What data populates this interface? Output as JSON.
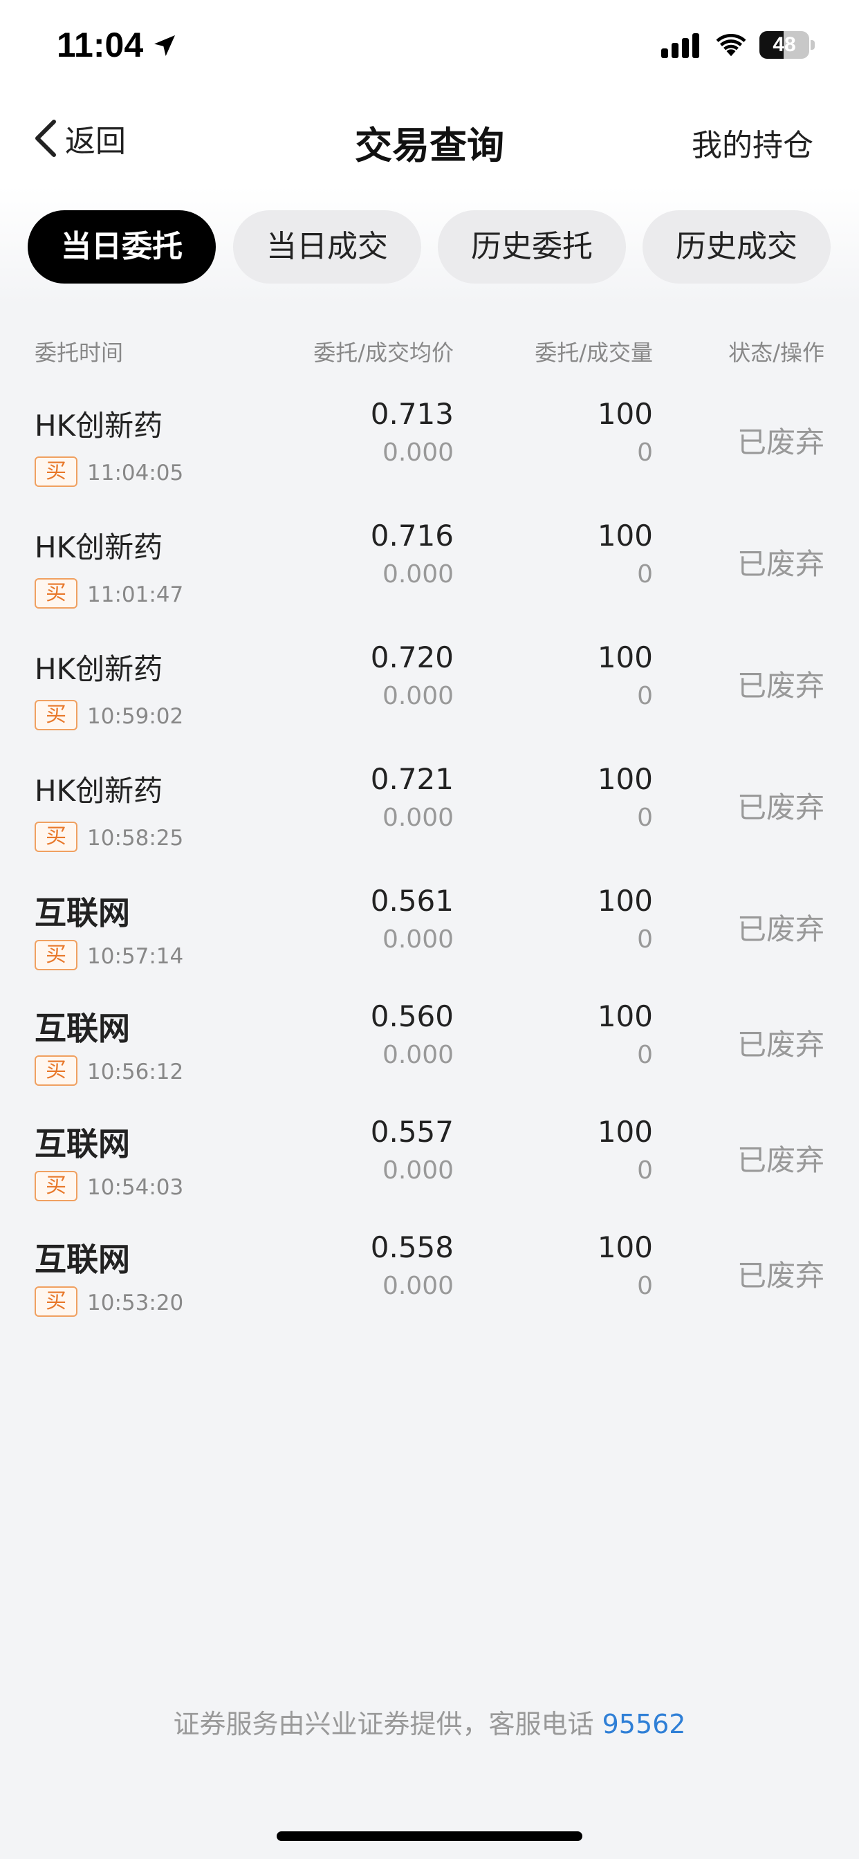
{
  "status_bar": {
    "time": "11:04",
    "battery": "48",
    "battery_level": 0.48,
    "icons": [
      "location-arrow-icon",
      "cellular-signal-icon",
      "wifi-icon",
      "battery-icon"
    ]
  },
  "nav": {
    "back_label": "返回",
    "title": "交易查询",
    "right_label": "我的持仓"
  },
  "tabs": [
    {
      "label": "当日委托",
      "active": true
    },
    {
      "label": "当日成交",
      "active": false
    },
    {
      "label": "历史委托",
      "active": false
    },
    {
      "label": "历史成交",
      "active": false
    }
  ],
  "table": {
    "headers": {
      "time": "委托时间",
      "price": "委托/成交均价",
      "qty": "委托/成交量",
      "status": "状态/操作"
    },
    "rows": [
      {
        "name": "HK创新药",
        "side": "买",
        "time": "11:04:05",
        "price": "0.713",
        "avg_price": "0.000",
        "qty": "100",
        "filled": "0",
        "status": "已废弃"
      },
      {
        "name": "HK创新药",
        "side": "买",
        "time": "11:01:47",
        "price": "0.716",
        "avg_price": "0.000",
        "qty": "100",
        "filled": "0",
        "status": "已废弃"
      },
      {
        "name": "HK创新药",
        "side": "买",
        "time": "10:59:02",
        "price": "0.720",
        "avg_price": "0.000",
        "qty": "100",
        "filled": "0",
        "status": "已废弃"
      },
      {
        "name": "HK创新药",
        "side": "买",
        "time": "10:58:25",
        "price": "0.721",
        "avg_price": "0.000",
        "qty": "100",
        "filled": "0",
        "status": "已废弃"
      },
      {
        "name": "互联网",
        "side": "买",
        "time": "10:57:14",
        "price": "0.561",
        "avg_price": "0.000",
        "qty": "100",
        "filled": "0",
        "status": "已废弃"
      },
      {
        "name": "互联网",
        "side": "买",
        "time": "10:56:12",
        "price": "0.560",
        "avg_price": "0.000",
        "qty": "100",
        "filled": "0",
        "status": "已废弃"
      },
      {
        "name": "互联网",
        "side": "买",
        "time": "10:54:03",
        "price": "0.557",
        "avg_price": "0.000",
        "qty": "100",
        "filled": "0",
        "status": "已废弃"
      },
      {
        "name": "互联网",
        "side": "买",
        "time": "10:53:20",
        "price": "0.558",
        "avg_price": "0.000",
        "qty": "100",
        "filled": "0",
        "status": "已废弃"
      }
    ]
  },
  "footer": {
    "note": "证券服务由兴业证券提供，客服电话 ",
    "phone": "95562"
  },
  "colors": {
    "active_tab": "#000000",
    "buy_badge": "#e8782a",
    "phone_link": "#2f7fd6"
  }
}
